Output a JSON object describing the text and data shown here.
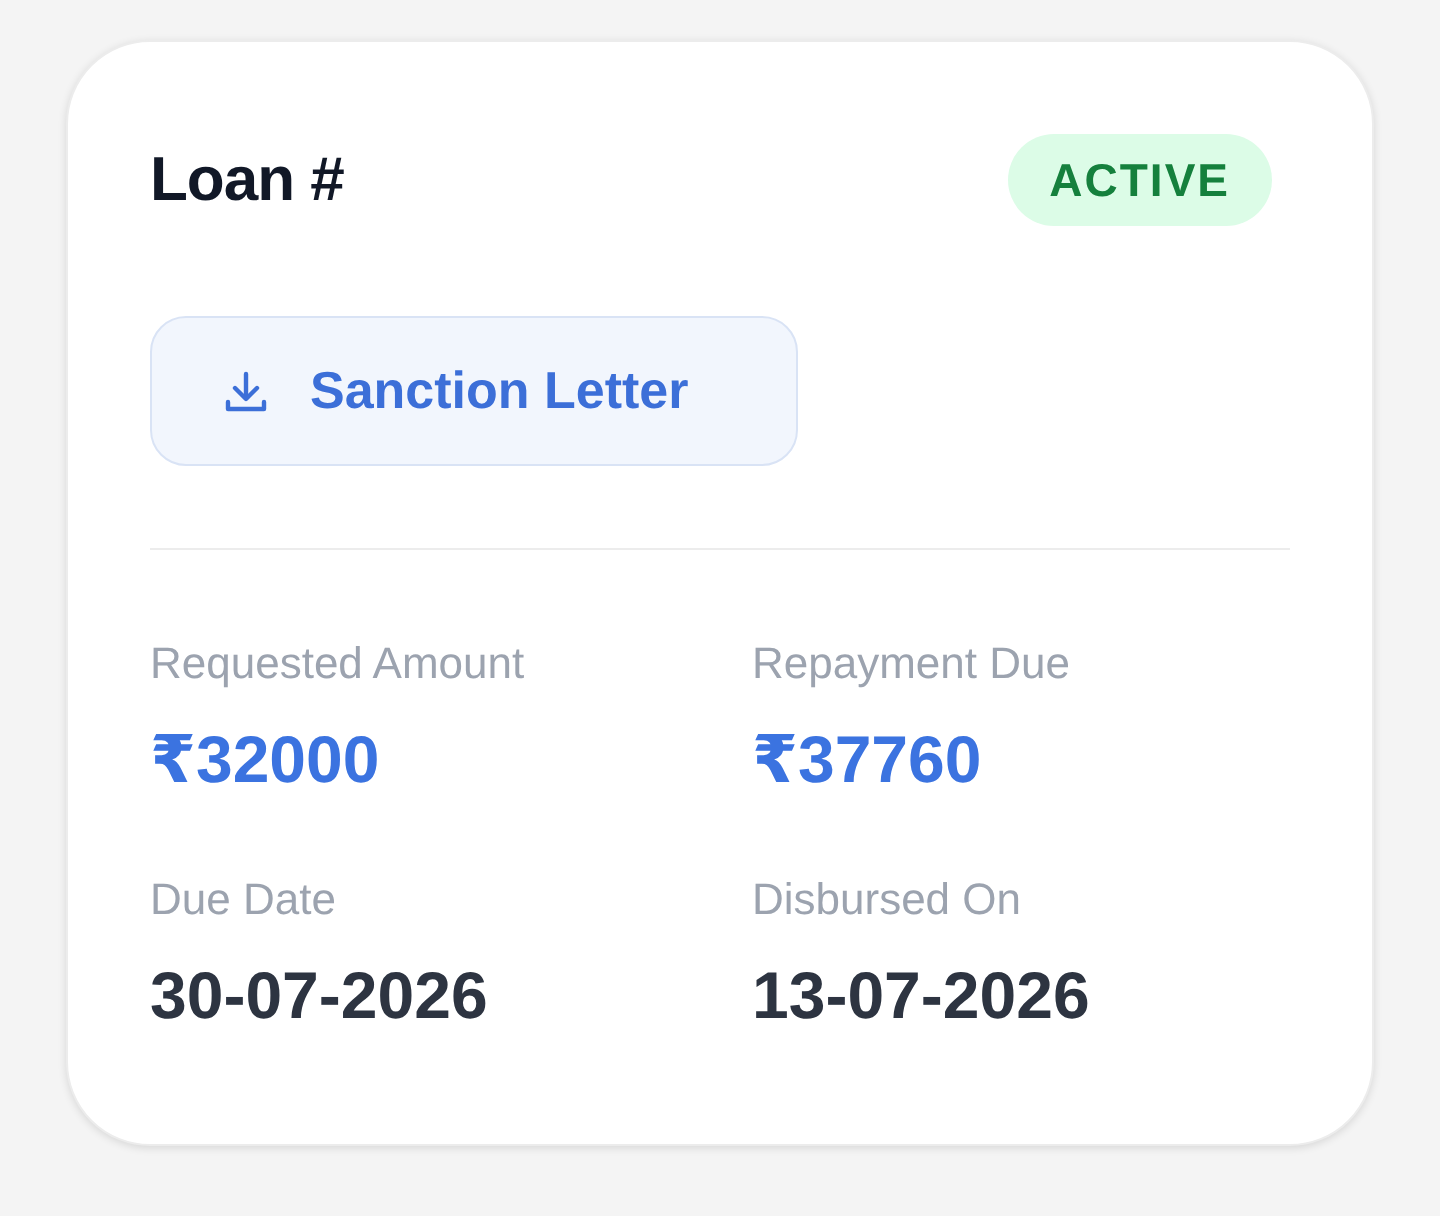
{
  "card": {
    "title": "Loan #",
    "status": {
      "label": "ACTIVE",
      "kind": "success"
    },
    "action": {
      "label": "Sanction Letter"
    },
    "details": [
      {
        "label": "Requested Amount",
        "value": "₹32000",
        "kind": "amount"
      },
      {
        "label": "Repayment Due",
        "value": "₹37760",
        "kind": "amount"
      },
      {
        "label": "Due Date",
        "value": "30-07-2026",
        "kind": "date"
      },
      {
        "label": "Disbursed On",
        "value": "13-07-2026",
        "kind": "date"
      }
    ]
  }
}
